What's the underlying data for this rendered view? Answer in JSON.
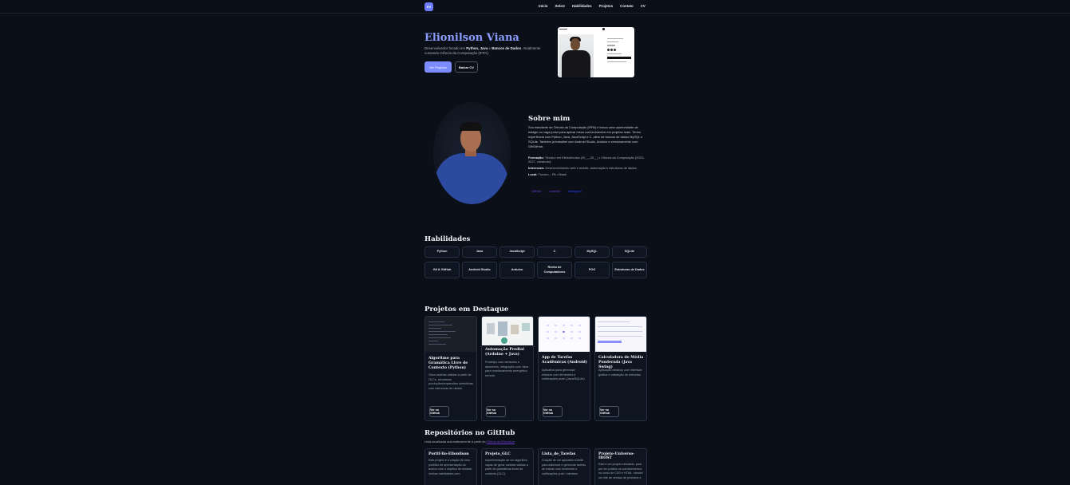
{
  "header": {
    "logo": "EV",
    "nav": [
      "Início",
      "Sobre",
      "Habilidades",
      "Projetos",
      "Contato",
      "CV"
    ]
  },
  "hero": {
    "title": "Elionilson Viana",
    "subtitle_pre": "Desenvolvedor focado em ",
    "subtitle_bold1": "Python, Java",
    "subtitle_mid": " e ",
    "subtitle_bold2": "Bancos de Dados",
    "subtitle_post": ". Atualmente cursando Ciência da Computação (IFPA).",
    "primary_button": "Ver Projetos",
    "secondary_button": "Baixar CV"
  },
  "about": {
    "title": "Sobre mim",
    "p1": "Sou estudante de Ciência da Computação (IFPA) e busco uma oportunidade de estágio ou vaga júnior para aplicar meus conhecimentos em projetos reais. Tenho experiência com Python, Java, JavaScript e C, além de bancos de dados MySQL e SQLite. Também já trabalhei com Android Studio, Arduino e versionamento com Git/GitHub.",
    "formacao_label": "Formação:",
    "formacao": "Técnico em Eletrotécnica (20__–20__) • Ciência da Computação (2023–2027, cursando).",
    "interesses_label": "Interesses:",
    "interesses": "Desenvolvimento web e mobile, automação e estruturas de dados.",
    "local_label": "Local:",
    "local": "Tucuruí – PA • Brasil",
    "links": [
      "GitHub",
      "LinkedIn",
      "Instagram"
    ]
  },
  "skills": {
    "title": "Habilidades",
    "items": [
      "Python",
      "Java",
      "JavaScript",
      "C",
      "MySQL",
      "SQLite",
      "Git & GitHub",
      "Android Studio",
      "Arduino",
      "Redes de Computadores",
      "POO",
      "Estruturas de Dados"
    ]
  },
  "projects": {
    "title": "Projetos em Destaque",
    "items": [
      {
        "title": "Algoritmo para Gramática Livre de Contexto (Python)",
        "desc": "Gera cadeias válidas a partir de GLCs, simulando produções/expansões simbólicas com estruturas de dados.",
        "button": "Ver no GitHub"
      },
      {
        "title": "Automação Predial (Arduino + Java)",
        "desc": "Protótipo com sensores e atuadores, integração com Java para monitoramento energético remoto.",
        "button": "Ver no GitHub"
      },
      {
        "title": "App de Tarefas Acadêmicas (Android)",
        "desc": "Aplicativo para gerenciar estudos com lembretes e notificações push (Java/SQLite).",
        "button": "Ver no GitHub"
      },
      {
        "title": "Calculadora de Média Ponderada (Java Swing)",
        "desc": "Aplicação desktop com interface gráfica e validação de entradas.",
        "button": "Ver no GitHub"
      }
    ]
  },
  "repos": {
    "title": "Repositórios no GitHub",
    "subtitle": "Lista atualizada automaticamente a partir do ",
    "subtitle_link": "GitHub do Elionilson",
    "items": [
      {
        "name": "Portif-lio-Elionilson",
        "desc": "Este projeto é a criação de meu portfólio de apresentação do acervo com o objetivo de mostrar minhas habilidades com"
      },
      {
        "name": "Projeto_GLC",
        "desc": "Implementação de um algoritmo capaz de gerar cadeias válidas a partir de gramáticas livres de contexto (GLC)."
      },
      {
        "name": "Lista_de_Tarefas",
        "desc": "Criação de um aplicativo mobile para adicionar e gerenciar tarefas de estudo com lembretes e notificações push. Interface"
      },
      {
        "name": "Projeto-Universo-IBOST",
        "desc": "Este é um projeto simulado, para por em prática os conhecimentos no curso de CSS e HTML. simulei um site de vendas de produtos e"
      }
    ]
  },
  "colors": {
    "accent": "#7c8cff",
    "title": "#8b9cff",
    "background": "#0b0f17",
    "link": "#6c3fd1"
  }
}
